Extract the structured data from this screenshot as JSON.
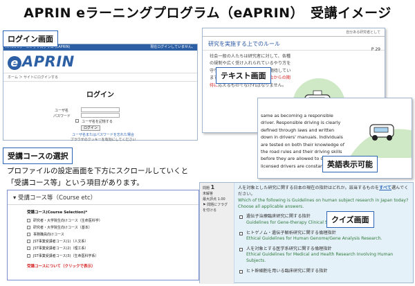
{
  "page_title": "APRIN eラーニングプログラム（eAPRIN）　受講イメージ",
  "labels": {
    "login_screen": "ログイン画面",
    "text_screen": "テキスト画面",
    "english_display": "英語表示可能",
    "course_selection": "受講コースの選択",
    "quiz_screen": "クイズ画面"
  },
  "login": {
    "topbar_left": "APRIN eラーニングプログラム (eAPRIN)",
    "topbar_right": "現在ログインしていません。",
    "logo_text": "APRIN",
    "breadcrumb": "ホーム ＞ サイトにログインする",
    "heading": "ログイン",
    "username_label": "ユーザ名",
    "password_label": "パスワード",
    "remember_label": "ユーザ名を記憶する",
    "login_button": "ログイン",
    "link_forgot": "ユーザ名またはパスワードを忘れた場合",
    "link_cookie": "ブラウザのクッキーを有効にしてください"
  },
  "course": {
    "description": "プロファイルの設定画面を下方にスクロールしていくと「受講コース等」という項目があります。",
    "header": "受講コース等（Course etc）",
    "selection_label": "受講コース(Course Selection)*",
    "items": [
      "研究者・大学院生向けコース（生命医科学）",
      "研究者・大学院生向けコース（基本）",
      "事務職員向けコース",
      "JST事業受講者コース(1)（人文系）",
      "JST事業受講者コース(2)（理工系）",
      "JST事業受講者コース(3)（生命医科学系）"
    ],
    "link": "受講コースについて（クリックで表示）"
  },
  "text_panel": {
    "header": "自分ある研究者として",
    "title": "研究を実施する上でのルール",
    "page": "P 29",
    "body_before": "社会一般の人たちは研究者に対して、各種の規制や広く受け入れられているやり方を守りながら研究を進めることを期待しています。責任ある研究行為は、",
    "body_highlight": "社会からの期待に",
    "body_after": "応えるものでなければなりません。"
  },
  "english_panel": {
    "body": "same as becoming a responsible driver. Responsible driving is clearly defined through laws and written down in drivers' manuals. Individuals are tested on both their knowledge of the road rules and their driving skills before they are allowed to drive. Then licensed drivers are constantly"
  },
  "quiz": {
    "question_label": "問題",
    "question_number": "1",
    "status": "未解答",
    "score_label": "最大評点 1.00",
    "flag_label": "問題にフラグを付ける",
    "question_jp_before": "人を対象とした研究に関する日本の現在の指針はどれか。該当するものを",
    "question_jp_emph": "すべて",
    "question_jp_after": "選んでください。",
    "question_en": "Which of the following is Guidelines on human subject research in Japan today? Choose all applicable answers.",
    "options": [
      {
        "jp": "遺伝子治療臨床研究に関する指針",
        "en": "Guidelines for Gene-therapy Clinical Studies."
      },
      {
        "jp": "ヒトゲノム・遺伝子解析研究に関する倫理指針",
        "en": "Ethical Guidelines for Human Genome/Gene Analysis Research."
      },
      {
        "jp": "人を対象とする医学系研究に関する倫理指針",
        "en": "Ethical Guidelines for Medical and Health Research Involving Human Subjects."
      },
      {
        "jp": "ヒト幹細胞を用いる臨床研究に関する指針",
        "en": ""
      }
    ]
  },
  "colors": {
    "accent_blue": "#2b63b7",
    "highlight_red": "#d42020",
    "english_green": "#2f7a3c",
    "quiz_bg": "#e5f1f8"
  }
}
